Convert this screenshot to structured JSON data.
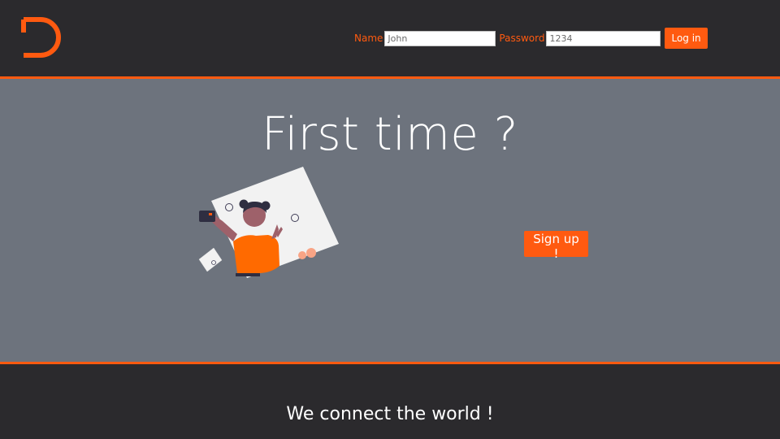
{
  "header": {
    "logo_icon": "d-logo-icon",
    "login": {
      "name_label": "Name",
      "name_value": "John",
      "password_label": "Password",
      "password_value": "1234",
      "button_label": "Log in"
    }
  },
  "main": {
    "headline": "First time ?",
    "illustration_icon": "selfie-person-illustration",
    "signup_label": "Sign up !"
  },
  "footer": {
    "tagline": "We connect the world !"
  },
  "colors": {
    "accent": "#ff5a10",
    "dark": "#2b2a2d",
    "panel": "#6d737d"
  }
}
